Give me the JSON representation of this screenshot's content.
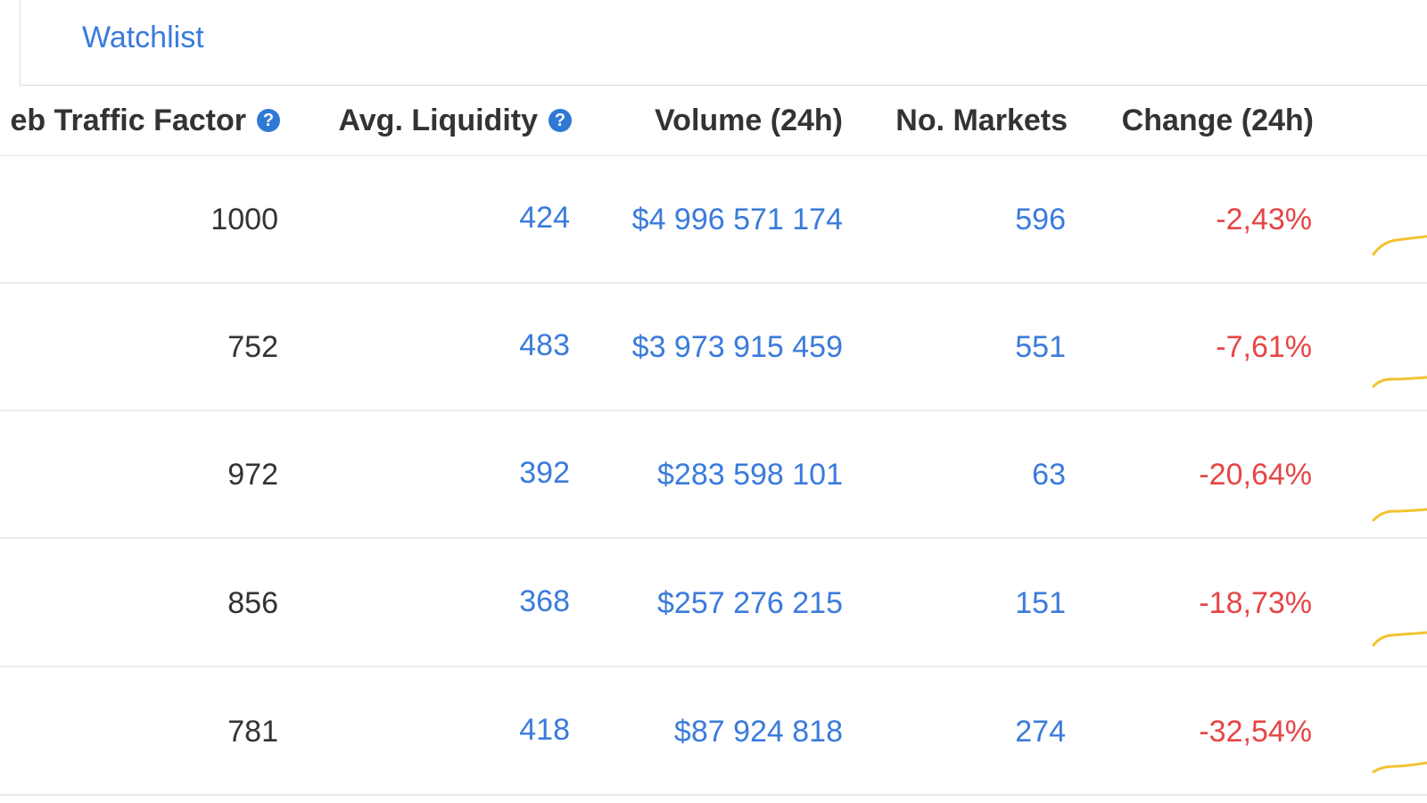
{
  "tabs": {
    "watchlist_label": "Watchlist"
  },
  "table": {
    "headers": {
      "traffic": "eb Traffic Factor",
      "liquidity": "Avg. Liquidity",
      "volume": "Volume (24h)",
      "markets": "No. Markets",
      "change": "Change (24h)"
    },
    "rows": [
      {
        "traffic": "1000",
        "liquidity": "424",
        "volume": "$4 996 571 174",
        "markets": "596",
        "change": "-2,43%"
      },
      {
        "traffic": "752",
        "liquidity": "483",
        "volume": "$3 973 915 459",
        "markets": "551",
        "change": "-7,61%"
      },
      {
        "traffic": "972",
        "liquidity": "392",
        "volume": "$283 598 101",
        "markets": "63",
        "change": "-20,64%"
      },
      {
        "traffic": "856",
        "liquidity": "368",
        "volume": "$257 276 215",
        "markets": "151",
        "change": "-18,73%"
      },
      {
        "traffic": "781",
        "liquidity": "418",
        "volume": "$87 924 818",
        "markets": "274",
        "change": "-32,54%"
      }
    ]
  },
  "icons": {
    "help": "question-circle-icon",
    "sparkline": "sparkline-chart-icon"
  },
  "colors": {
    "link": "#3a7bdc",
    "negative": "#e64545",
    "help_icon": "#2f78d4",
    "sparkline": "#f2c230",
    "text": "#333333"
  }
}
